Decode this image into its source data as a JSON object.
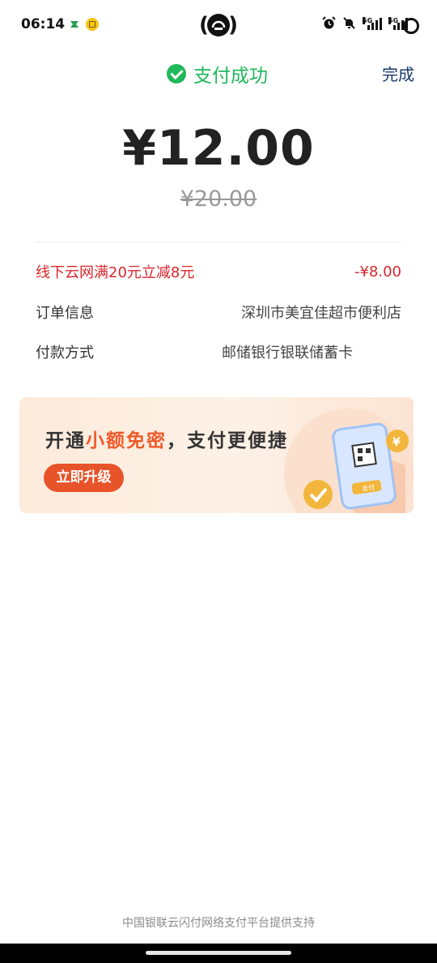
{
  "status_bar": {
    "time": "06:14",
    "signal_1_label": "5G",
    "signal_2_label": "5G"
  },
  "header": {
    "title": "支付成功",
    "done_label": "完成"
  },
  "payment": {
    "amount": "¥12.00",
    "original_amount": "¥20.00"
  },
  "details": {
    "discount_label": "线下云网满20元立减8元",
    "discount_value": "-¥8.00",
    "order_label": "订单信息",
    "order_value": "深圳市美宜佳超市便利店",
    "method_label": "付款方式",
    "method_value": "邮储银行银联储蓄卡"
  },
  "banner": {
    "title_prefix": "开通",
    "title_highlight": "小额免密",
    "title_suffix": "，支付更便捷",
    "button_label": "立即升级",
    "art_pay_label": "支付"
  },
  "footer": {
    "text": "中国银联云闪付网络支付平台提供支持"
  },
  "colors": {
    "success_green": "#1fb85a",
    "discount_red": "#d8262c",
    "accent_orange": "#e8542a"
  }
}
